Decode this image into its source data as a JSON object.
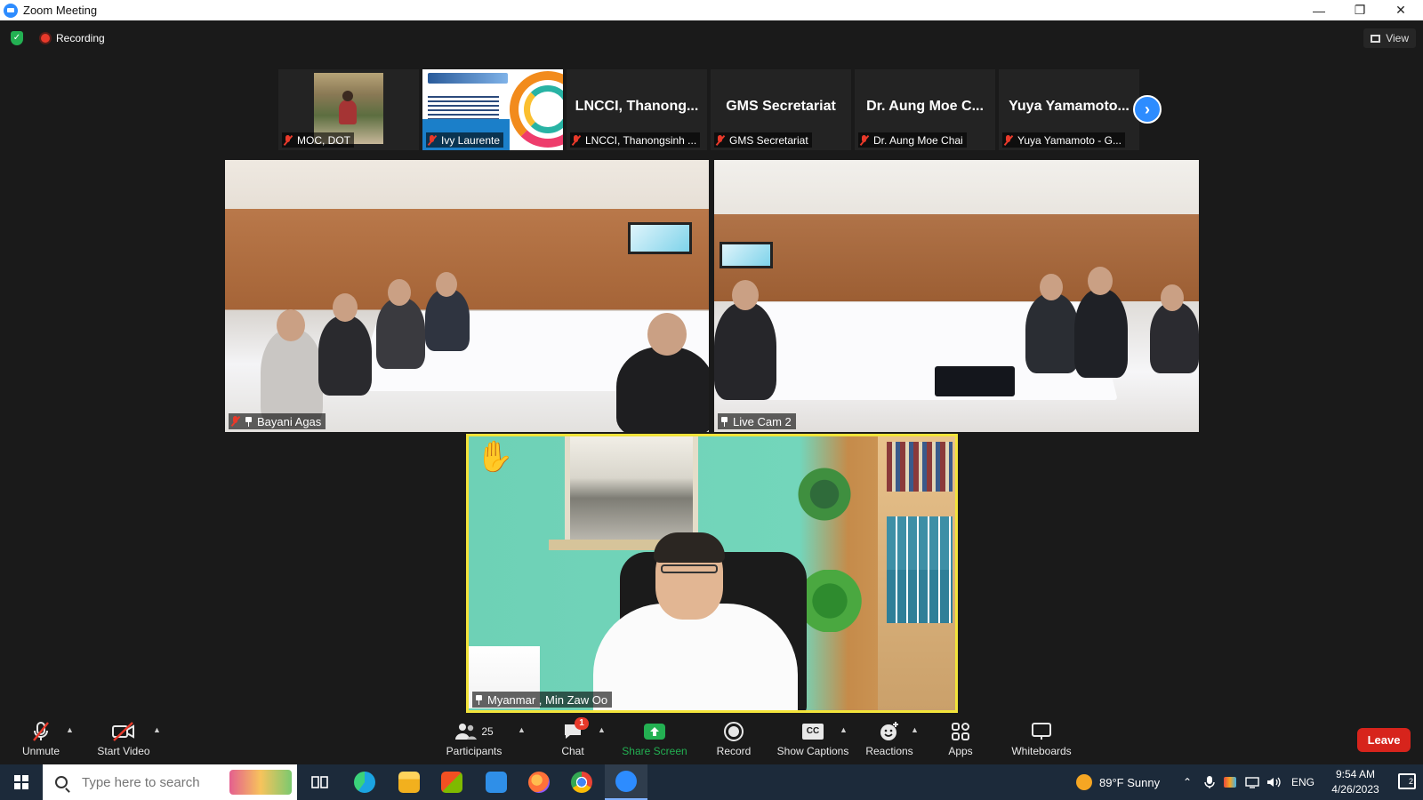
{
  "window": {
    "title": "Zoom Meeting"
  },
  "top_bar": {
    "recording_label": "Recording",
    "view_label": "View"
  },
  "thumbnails": [
    {
      "big_name": "",
      "label": "MOC, DOT",
      "muted": true
    },
    {
      "big_name": "",
      "label": "Ivy Laurente",
      "muted": true
    },
    {
      "big_name": "LNCCI,  Thanong...",
      "label": "LNCCI, Thanongsinh ...",
      "muted": true
    },
    {
      "big_name": "GMS Secretariat",
      "label": "GMS Secretariat",
      "muted": true
    },
    {
      "big_name": "Dr. Aung Moe C...",
      "label": "Dr. Aung Moe Chai",
      "muted": true
    },
    {
      "big_name": "Yuya  Yamamoto...",
      "label": "Yuya Yamamoto - G...",
      "muted": true
    }
  ],
  "main_tiles": {
    "tile1": {
      "label": "Bayani Agas"
    },
    "tile2": {
      "label": "Live Cam 2"
    },
    "tile3": {
      "label": "Myanmar ,  Min Zaw Oo"
    }
  },
  "toolbar": {
    "unmute": "Unmute",
    "start_video": "Start Video",
    "participants": "Participants",
    "participants_count": "25",
    "chat": "Chat",
    "chat_badge": "1",
    "share_screen": "Share Screen",
    "record": "Record",
    "show_captions": "Show Captions",
    "captions_icon_text": "CC",
    "reactions": "Reactions",
    "apps": "Apps",
    "whiteboards": "Whiteboards",
    "leave": "Leave"
  },
  "taskbar": {
    "search_placeholder": "Type here to search",
    "weather": "89°F  Sunny",
    "language": "ENG",
    "time": "9:54 AM",
    "date": "4/26/2023",
    "notification_count": "2"
  },
  "colors": {
    "zoom_blue": "#2d8cff",
    "mute_red": "#e8392a",
    "leave_red": "#d7241c",
    "share_green": "#23b052",
    "active_speaker": "#f2e33a"
  }
}
